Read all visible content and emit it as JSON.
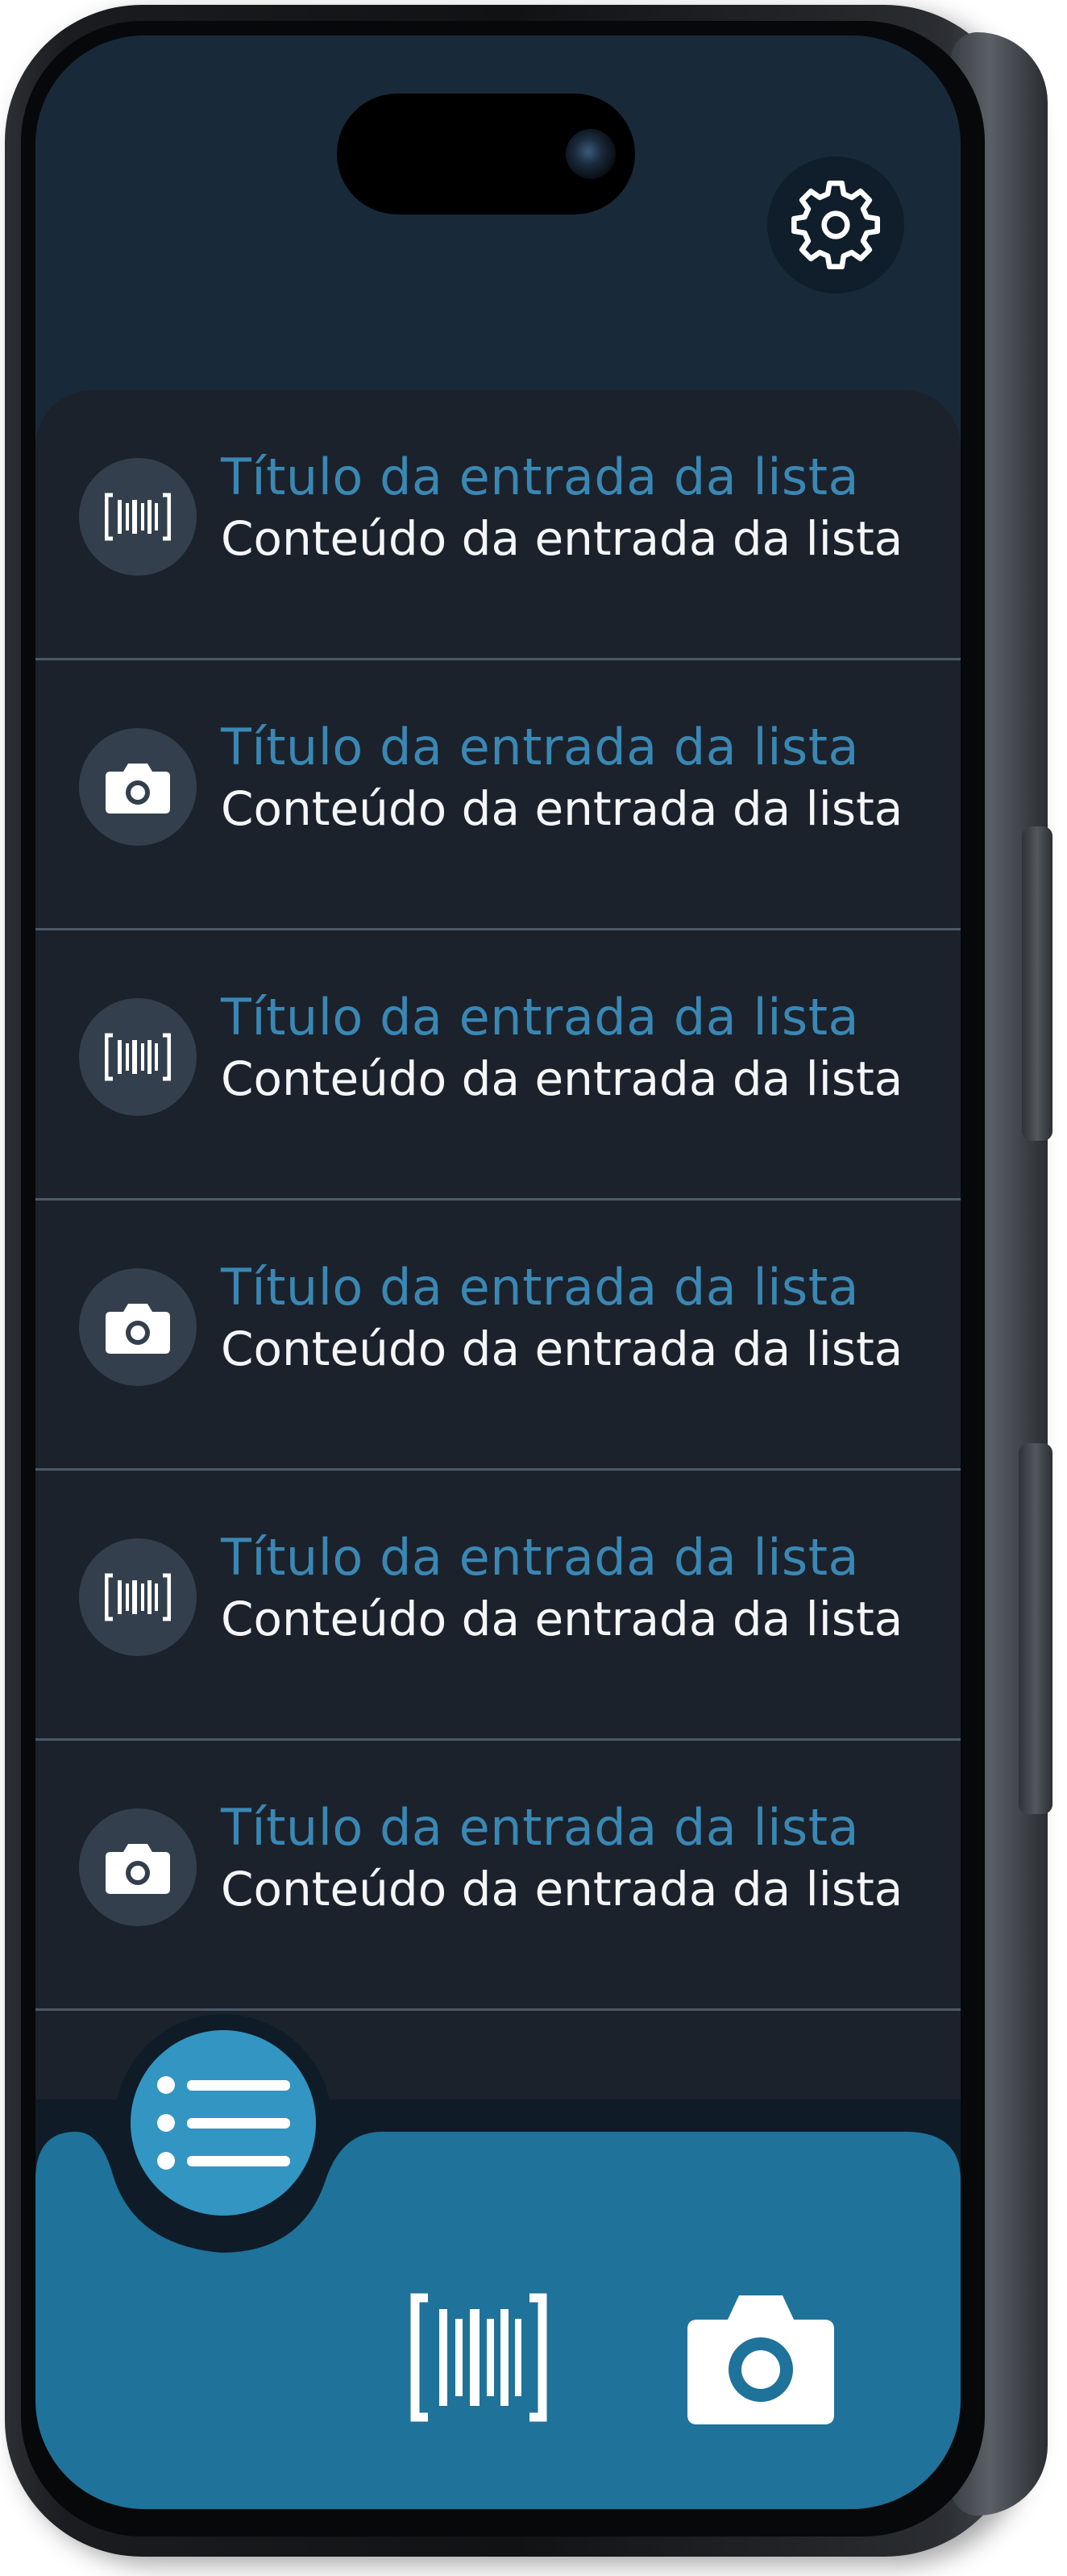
{
  "theme": {
    "accent": "#3a87b3",
    "fab": "#3395c2",
    "bottom_bar": "#1f7299",
    "list_bg": "#1b222c",
    "header_bg": "#182a39"
  },
  "header": {
    "settings_icon": "gear-icon"
  },
  "list": {
    "items": [
      {
        "icon": "barcode-icon",
        "title": "Título da entrada da lista",
        "content": "Conteúdo da entrada da lista"
      },
      {
        "icon": "camera-icon",
        "title": "Título da entrada da lista",
        "content": "Conteúdo da entrada da lista"
      },
      {
        "icon": "barcode-icon",
        "title": "Título da entrada da lista",
        "content": "Conteúdo da entrada da lista"
      },
      {
        "icon": "camera-icon",
        "title": "Título da entrada da lista",
        "content": "Conteúdo da entrada da lista"
      },
      {
        "icon": "barcode-icon",
        "title": "Título da entrada da lista",
        "content": "Conteúdo da entrada da lista"
      },
      {
        "icon": "camera-icon",
        "title": "Título da entrada da lista",
        "content": "Conteúdo da entrada da lista"
      }
    ]
  },
  "bottom_nav": {
    "items": [
      {
        "icon": "list-icon",
        "active": true
      },
      {
        "icon": "barcode-icon",
        "active": false
      },
      {
        "icon": "camera-icon",
        "active": false
      }
    ]
  }
}
